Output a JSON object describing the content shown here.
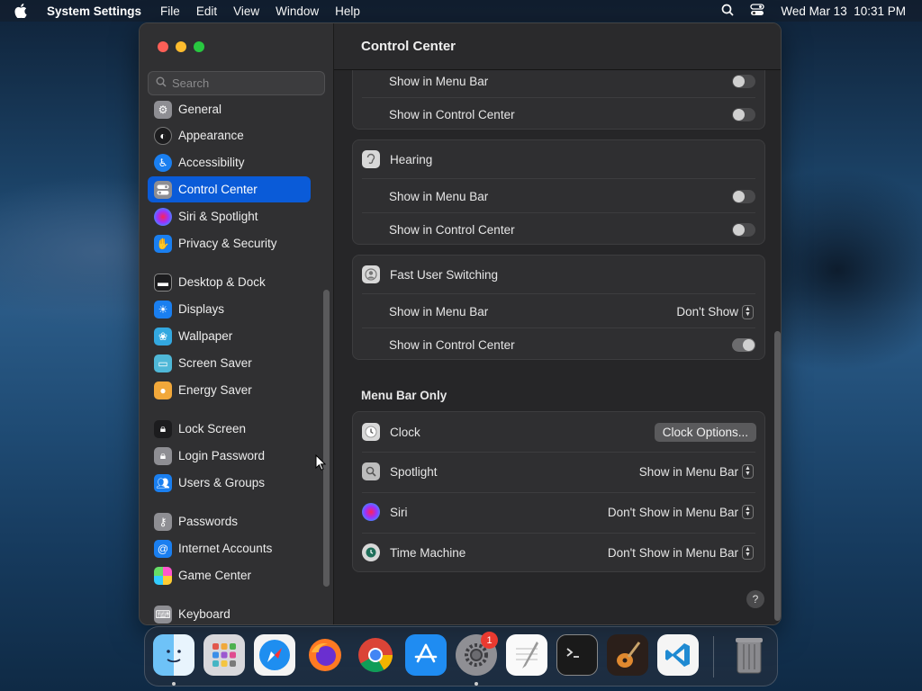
{
  "menubar": {
    "app_name": "System Settings",
    "menus": [
      "File",
      "Edit",
      "View",
      "Window",
      "Help"
    ],
    "datetime": "Wed Mar 13  10:31 PM"
  },
  "sidebar": {
    "search_placeholder": "Search",
    "items": [
      {
        "label": "General",
        "icon": "gear-icon",
        "color": "#8e8e93"
      },
      {
        "label": "Appearance",
        "icon": "appearance-icon",
        "color": "#1c1c1e"
      },
      {
        "label": "Accessibility",
        "icon": "accessibility-icon",
        "color": "#1a7ff0"
      },
      {
        "label": "Control Center",
        "icon": "control-center-icon",
        "color": "#8e8e93",
        "selected": true
      },
      {
        "label": "Siri & Spotlight",
        "icon": "siri-icon",
        "color": "#b33ad6"
      },
      {
        "label": "Privacy & Security",
        "icon": "hand-icon",
        "color": "#1a7ff0"
      },
      {
        "label": "Desktop & Dock",
        "icon": "dock-icon",
        "color": "#1c1c1e"
      },
      {
        "label": "Displays",
        "icon": "sun-icon",
        "color": "#1a7ff0"
      },
      {
        "label": "Wallpaper",
        "icon": "wallpaper-icon",
        "color": "#33a8e0"
      },
      {
        "label": "Screen Saver",
        "icon": "screen-saver-icon",
        "color": "#4fb8d8"
      },
      {
        "label": "Energy Saver",
        "icon": "bulb-icon",
        "color": "#f2a83a"
      },
      {
        "label": "Lock Screen",
        "icon": "lock-icon",
        "color": "#1c1c1e"
      },
      {
        "label": "Login Password",
        "icon": "lock-icon",
        "color": "#8e8e93"
      },
      {
        "label": "Users & Groups",
        "icon": "users-icon",
        "color": "#1a7ff0"
      },
      {
        "label": "Passwords",
        "icon": "key-icon",
        "color": "#8e8e93"
      },
      {
        "label": "Internet Accounts",
        "icon": "at-icon",
        "color": "#1a7ff0"
      },
      {
        "label": "Game Center",
        "icon": "game-center-icon",
        "color": "#e8e8e8"
      },
      {
        "label": "Keyboard",
        "icon": "keyboard-icon",
        "color": "#8e8e93"
      }
    ]
  },
  "main": {
    "title": "Control Center",
    "partial_group": {
      "rows": [
        {
          "label": "Show in Menu Bar",
          "toggle": false
        },
        {
          "label": "Show in Control Center",
          "toggle": false
        }
      ]
    },
    "hearing": {
      "title": "Hearing",
      "rows": [
        {
          "label": "Show in Menu Bar",
          "toggle": false
        },
        {
          "label": "Show in Control Center",
          "toggle": false
        }
      ]
    },
    "fast_user_switching": {
      "title": "Fast User Switching",
      "menu_bar_label": "Show in Menu Bar",
      "menu_bar_value": "Don't Show",
      "control_center_label": "Show in Control Center",
      "control_center_toggle": true
    },
    "menu_bar_only": {
      "section_title": "Menu Bar Only",
      "clock": {
        "label": "Clock",
        "button": "Clock Options..."
      },
      "spotlight": {
        "label": "Spotlight",
        "value": "Show in Menu Bar"
      },
      "siri": {
        "label": "Siri",
        "value": "Don't Show in Menu Bar"
      },
      "time_machine": {
        "label": "Time Machine",
        "value": "Don't Show in Menu Bar"
      }
    },
    "help": "?"
  },
  "dock": {
    "apps": [
      "Finder",
      "Launchpad",
      "Safari",
      "Firefox",
      "Chrome",
      "App Store",
      "System Settings",
      "TextEdit",
      "Terminal",
      "GarageBand",
      "VS Code",
      "Trash"
    ],
    "badge": "1"
  }
}
